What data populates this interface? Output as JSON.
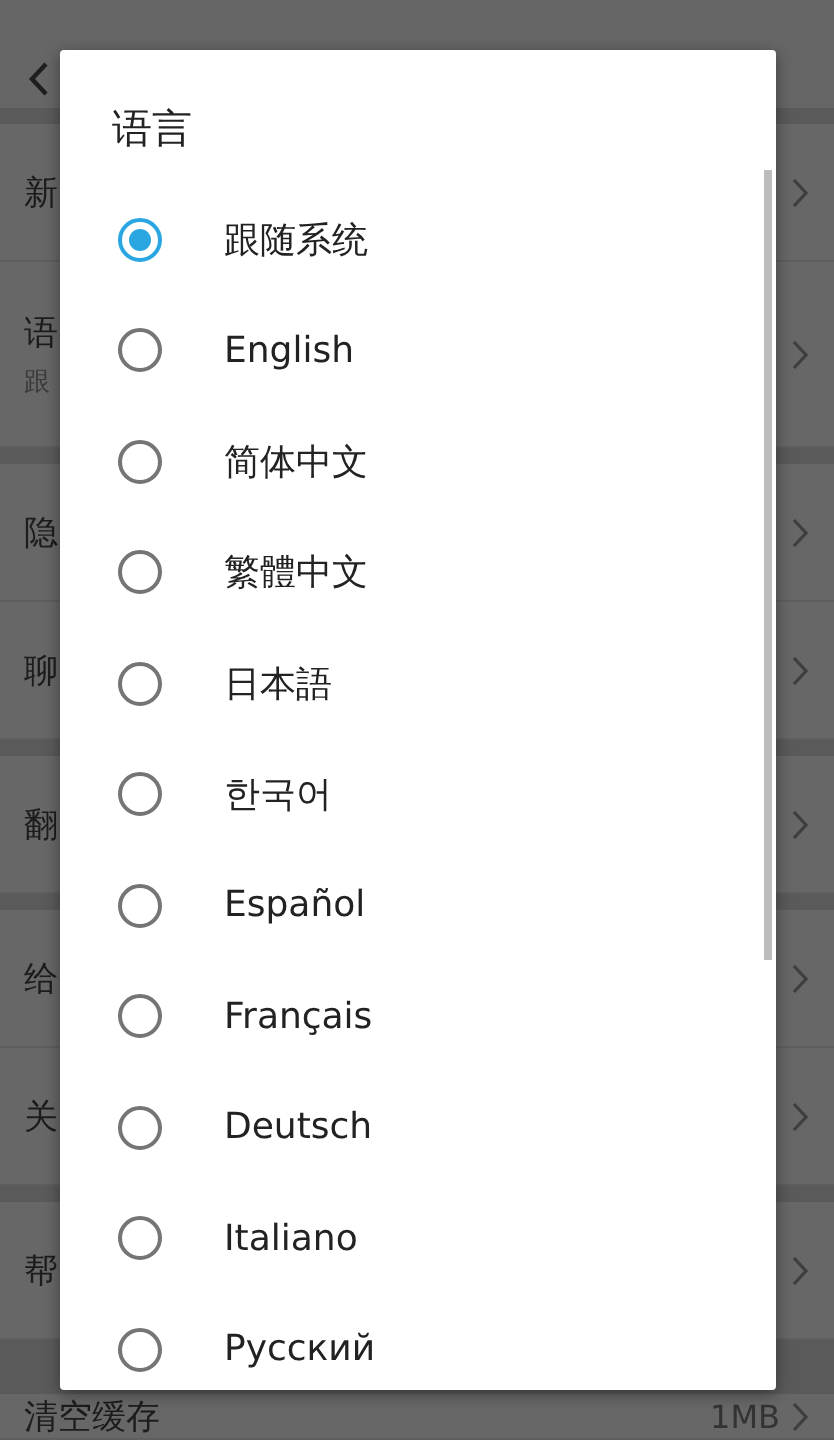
{
  "background": {
    "sections": [
      {
        "rows": [
          {
            "label": "新"
          },
          {
            "label": "语",
            "subtitle": "跟"
          }
        ]
      },
      {
        "rows": [
          {
            "label": "隐"
          },
          {
            "label": "聊"
          }
        ]
      },
      {
        "rows": [
          {
            "label": "翻"
          }
        ]
      },
      {
        "rows": [
          {
            "label": "给"
          },
          {
            "label": "关"
          }
        ]
      },
      {
        "rows": [
          {
            "label": "帮"
          }
        ]
      },
      {
        "rows": [
          {
            "label": "清空缓存",
            "value": "1MB"
          }
        ]
      }
    ]
  },
  "dialog": {
    "title": "语言",
    "options": [
      {
        "label": "跟随系统",
        "selected": true
      },
      {
        "label": "English",
        "selected": false
      },
      {
        "label": "简体中文",
        "selected": false
      },
      {
        "label": "繁體中文",
        "selected": false
      },
      {
        "label": "日本語",
        "selected": false
      },
      {
        "label": "한국어",
        "selected": false
      },
      {
        "label": "Español",
        "selected": false
      },
      {
        "label": "Français",
        "selected": false
      },
      {
        "label": "Deutsch",
        "selected": false
      },
      {
        "label": "Italiano",
        "selected": false
      },
      {
        "label": "Русский",
        "selected": false
      }
    ]
  }
}
